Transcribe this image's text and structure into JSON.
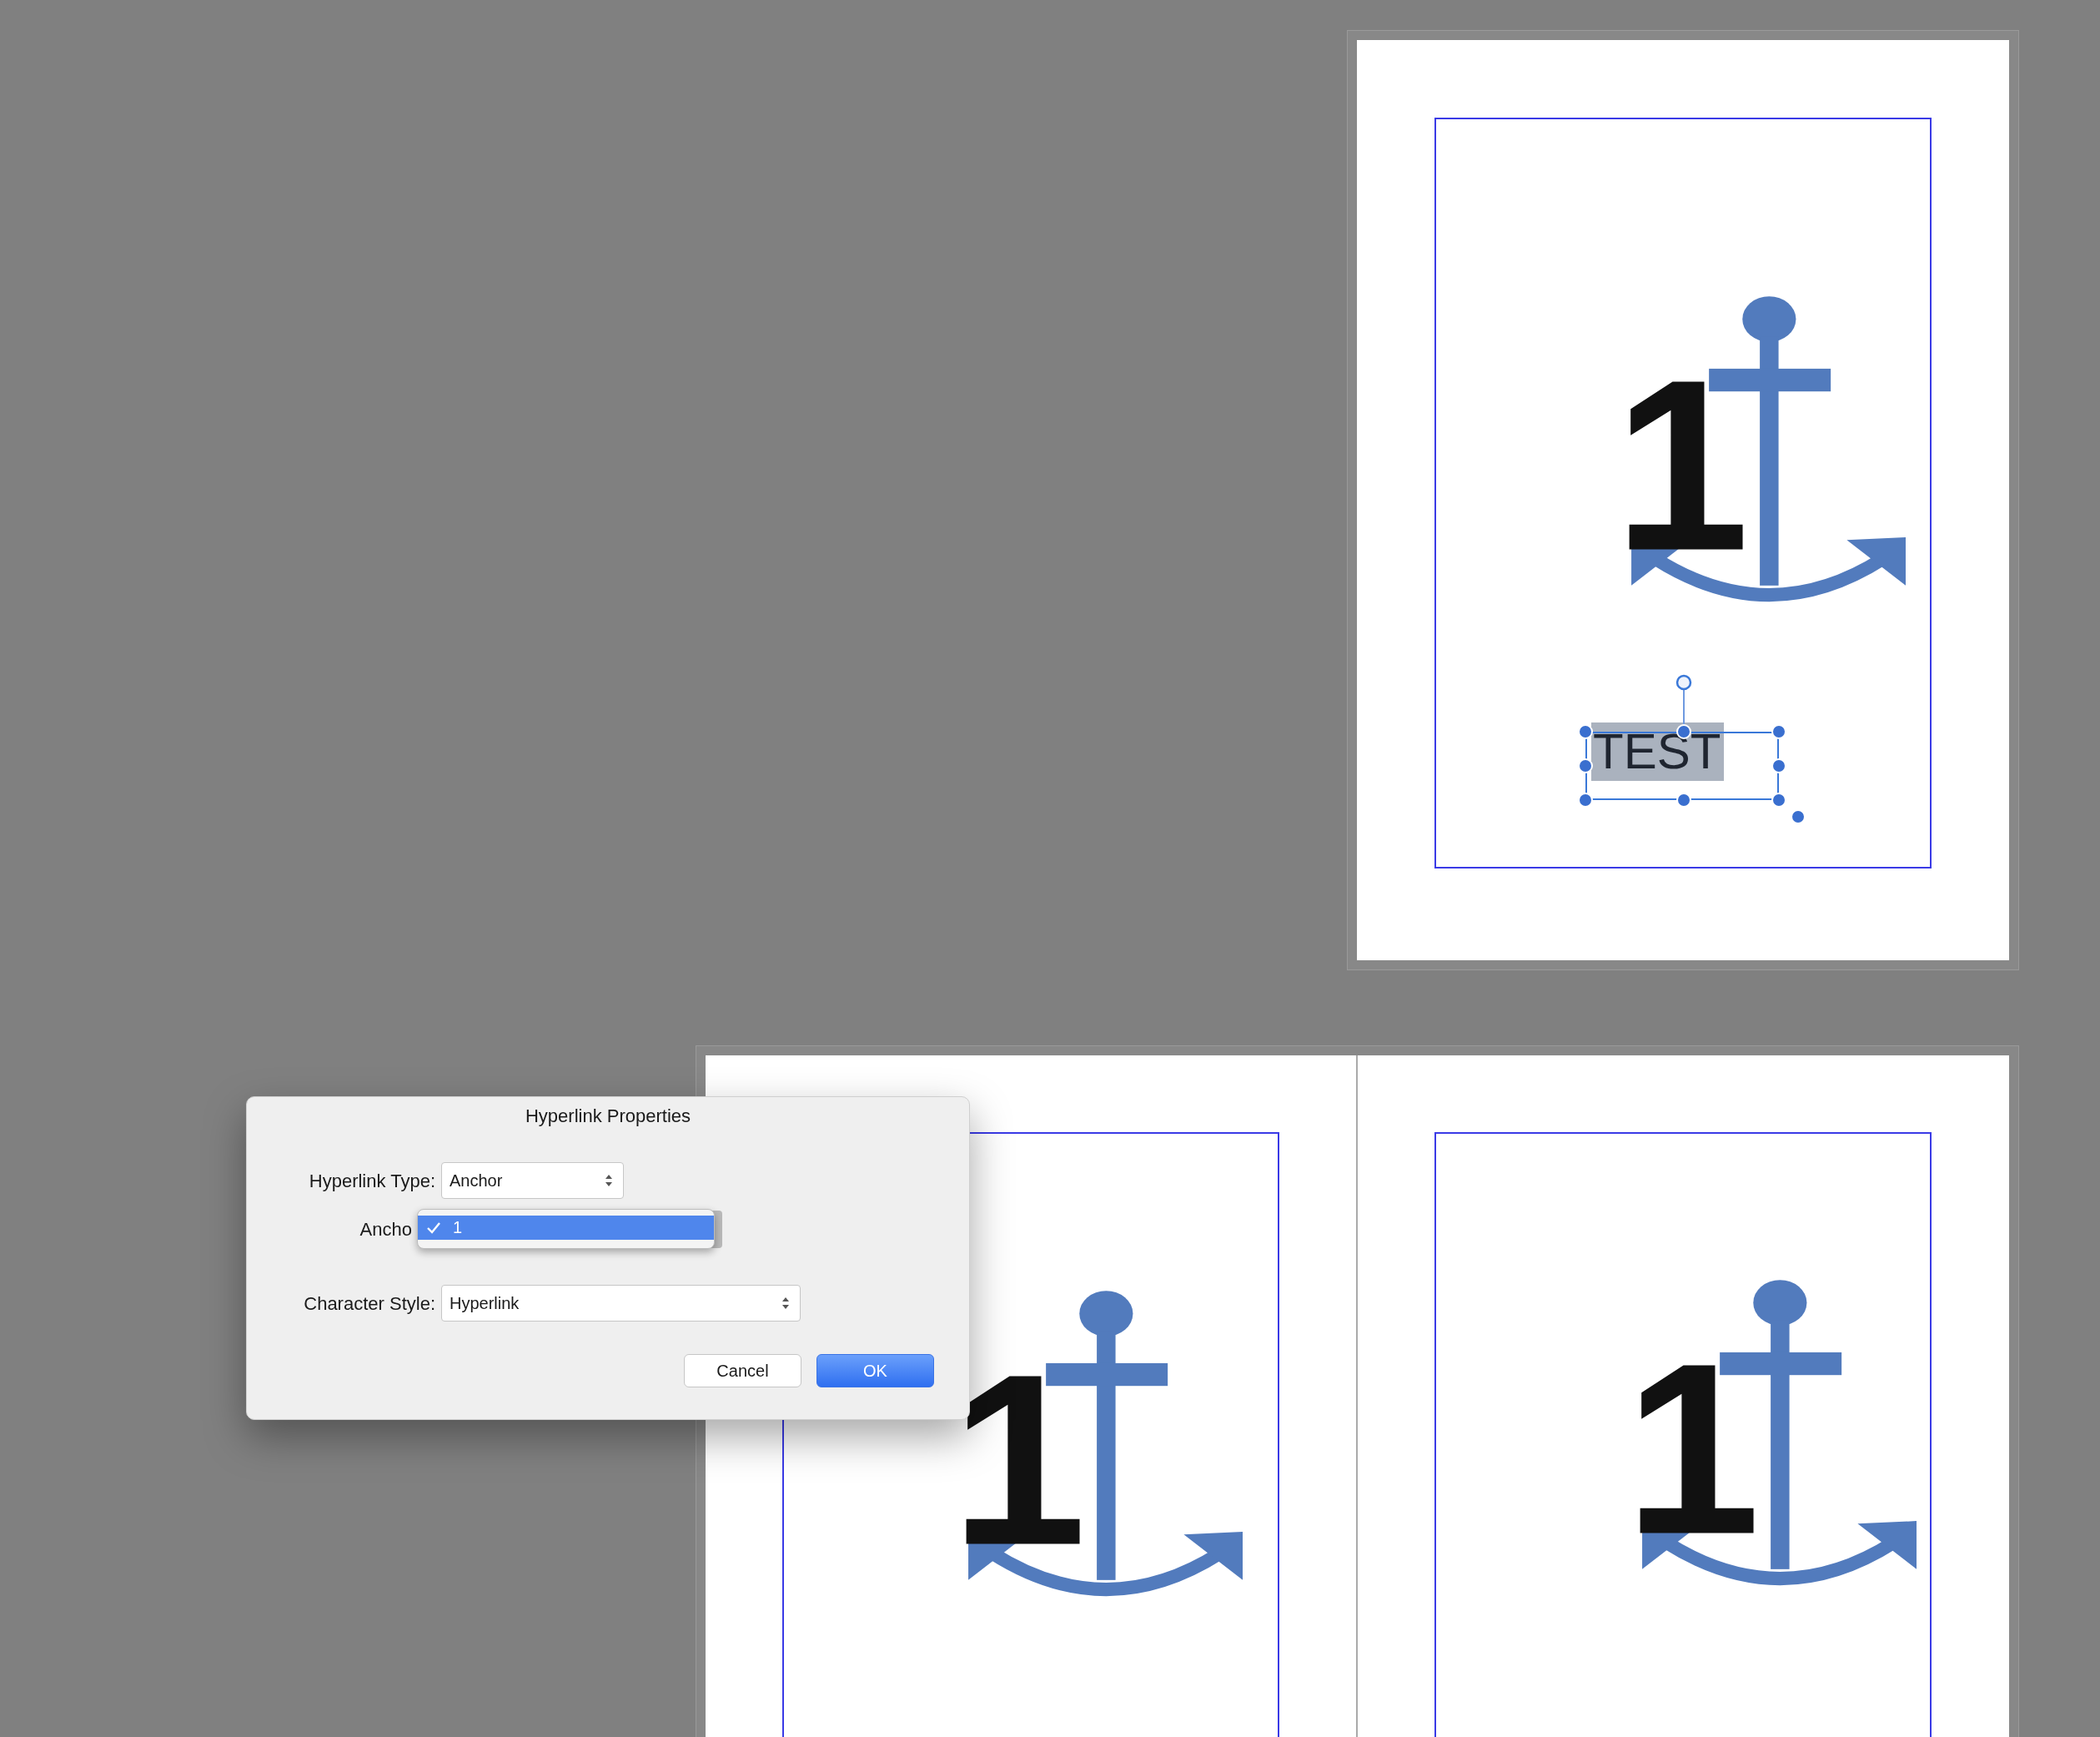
{
  "pages": [
    {
      "number": "1",
      "text_frame": {
        "text": "TEST",
        "selected": true
      }
    },
    {
      "number": "1"
    },
    {
      "number": "1"
    }
  ],
  "dialog": {
    "title": "Hyperlink Properties",
    "fields": [
      {
        "kind": "select",
        "label": "Hyperlink Type:",
        "value": "Anchor"
      },
      {
        "kind": "popup",
        "label": "Ancho",
        "options": [
          {
            "label": "1",
            "checked": true
          }
        ]
      },
      {
        "kind": "select",
        "label": "Character Style:",
        "value": "Hyperlink"
      }
    ],
    "buttons": [
      {
        "label": "Cancel",
        "default": false
      },
      {
        "label": "OK",
        "default": true
      }
    ]
  }
}
